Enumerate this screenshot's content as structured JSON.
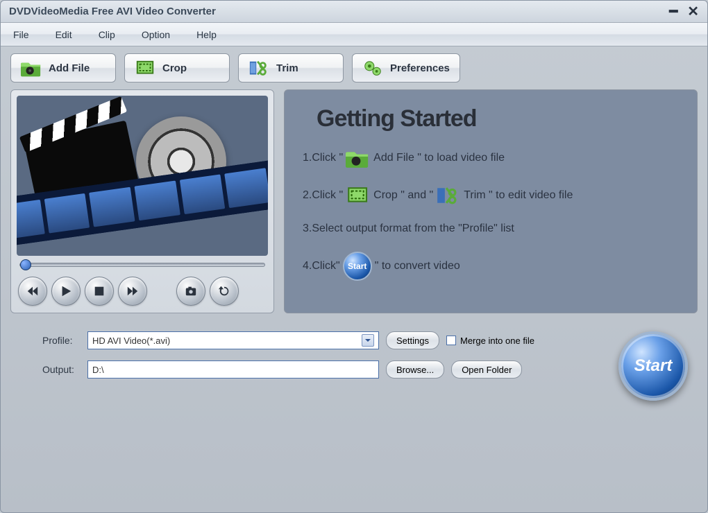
{
  "window": {
    "title": "DVDVideoMedia Free AVI Video Converter"
  },
  "menu": {
    "file": "File",
    "edit": "Edit",
    "clip": "Clip",
    "option": "Option",
    "help": "Help"
  },
  "toolbar": {
    "add_file": "Add File",
    "crop": "Crop",
    "trim": "Trim",
    "preferences": "Preferences"
  },
  "guide": {
    "title": "Getting Started",
    "step1_a": "1.Click \"",
    "step1_b": "Add File \" to load video file",
    "step2_a": "2.Click \"",
    "step2_b": " Crop \" and \"",
    "step2_c": " Trim \" to edit video file",
    "step3": "3.Select output format from the \"Profile\" list",
    "step4_a": "4.Click\"",
    "step4_b": "\" to convert video",
    "mini_start": "Start"
  },
  "bottom": {
    "profile_label": "Profile:",
    "profile_value": "HD AVI Video(*.avi)",
    "output_label": "Output:",
    "output_value": "D:\\",
    "settings": "Settings",
    "browse": "Browse...",
    "open_folder": "Open Folder",
    "merge": "Merge into one file",
    "start": "Start"
  }
}
